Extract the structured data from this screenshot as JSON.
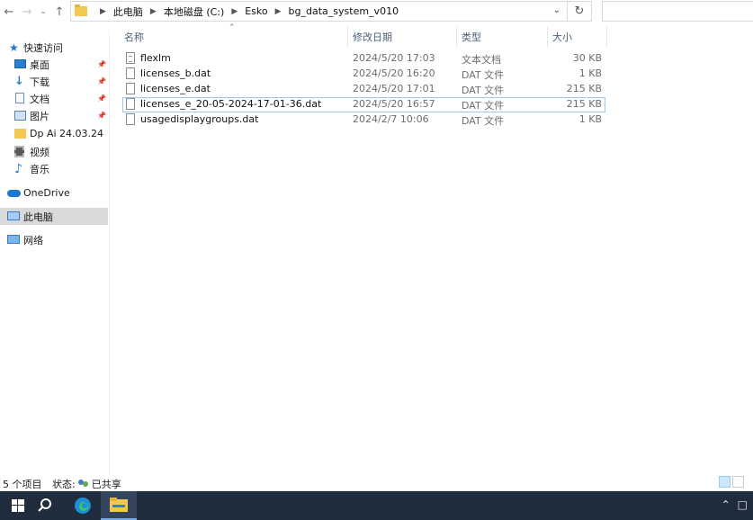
{
  "address": {
    "crumbs": [
      "此电脑",
      "本地磁盘 (C:)",
      "Esko",
      "bg_data_system_v010"
    ]
  },
  "sidebar": {
    "items": [
      {
        "label": "快速访问"
      },
      {
        "label": "桌面"
      },
      {
        "label": "下载"
      },
      {
        "label": "文档"
      },
      {
        "label": "图片"
      },
      {
        "label": "Dp Ai 24.03.24"
      },
      {
        "label": "视频"
      },
      {
        "label": "音乐"
      },
      {
        "label": "OneDrive"
      },
      {
        "label": "此电脑"
      },
      {
        "label": "网络"
      }
    ]
  },
  "columns": {
    "name": "名称",
    "date": "修改日期",
    "type": "类型",
    "size": "大小"
  },
  "files": [
    {
      "name": "flexlm",
      "date": "2024/5/20 17:03",
      "type": "文本文档",
      "size": "30 KB"
    },
    {
      "name": "licenses_b.dat",
      "date": "2024/5/20 16:20",
      "type": "DAT 文件",
      "size": "1 KB"
    },
    {
      "name": "licenses_e.dat",
      "date": "2024/5/20 17:01",
      "type": "DAT 文件",
      "size": "215 KB"
    },
    {
      "name": "licenses_e_20-05-2024-17-01-36.dat",
      "date": "2024/5/20 16:57",
      "type": "DAT 文件",
      "size": "215 KB"
    },
    {
      "name": "usagedisplaygroups.dat",
      "date": "2024/2/7 10:06",
      "type": "DAT 文件",
      "size": "1 KB"
    }
  ],
  "status": {
    "count": "5 个项目",
    "state_label": "状态:",
    "state_value": "已共享"
  },
  "colors": {
    "folder": "#f3c84f",
    "accent": "#0078d7",
    "selected_nav": "#d9d9d9",
    "taskbar": "#1f2c3e"
  }
}
